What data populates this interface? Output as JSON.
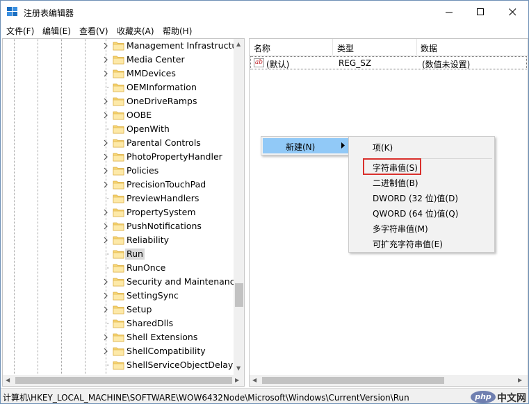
{
  "window": {
    "title": "注册表编辑器"
  },
  "menu": [
    "文件(F)",
    "编辑(E)",
    "查看(V)",
    "收藏夹(A)",
    "帮助(H)"
  ],
  "tree": {
    "items": [
      {
        "label": "Management Infrastructure",
        "expandable": true,
        "selected": false
      },
      {
        "label": "Media Center",
        "expandable": true,
        "selected": false
      },
      {
        "label": "MMDevices",
        "expandable": true,
        "selected": false
      },
      {
        "label": "OEMInformation",
        "expandable": false,
        "selected": false
      },
      {
        "label": "OneDriveRamps",
        "expandable": true,
        "selected": false
      },
      {
        "label": "OOBE",
        "expandable": true,
        "selected": false
      },
      {
        "label": "OpenWith",
        "expandable": false,
        "selected": false
      },
      {
        "label": "Parental Controls",
        "expandable": true,
        "selected": false
      },
      {
        "label": "PhotoPropertyHandler",
        "expandable": true,
        "selected": false
      },
      {
        "label": "Policies",
        "expandable": true,
        "selected": false
      },
      {
        "label": "PrecisionTouchPad",
        "expandable": true,
        "selected": false
      },
      {
        "label": "PreviewHandlers",
        "expandable": false,
        "selected": false
      },
      {
        "label": "PropertySystem",
        "expandable": true,
        "selected": false
      },
      {
        "label": "PushNotifications",
        "expandable": true,
        "selected": false
      },
      {
        "label": "Reliability",
        "expandable": true,
        "selected": false
      },
      {
        "label": "Run",
        "expandable": false,
        "selected": true
      },
      {
        "label": "RunOnce",
        "expandable": false,
        "selected": false
      },
      {
        "label": "Security and Maintenance",
        "expandable": true,
        "selected": false
      },
      {
        "label": "SettingSync",
        "expandable": true,
        "selected": false
      },
      {
        "label": "Setup",
        "expandable": true,
        "selected": false
      },
      {
        "label": "SharedDlls",
        "expandable": false,
        "selected": false
      },
      {
        "label": "Shell Extensions",
        "expandable": true,
        "selected": false
      },
      {
        "label": "ShellCompatibility",
        "expandable": true,
        "selected": false
      },
      {
        "label": "ShellServiceObjectDelayLoad",
        "expandable": false,
        "selected": false
      }
    ]
  },
  "list": {
    "columns": [
      "名称",
      "类型",
      "数据"
    ],
    "rows": [
      {
        "name": "(默认)",
        "type": "REG_SZ",
        "data": "(数值未设置)"
      }
    ]
  },
  "context_menu": {
    "parent": {
      "label": "新建(N)"
    },
    "submenu": [
      "项(K)",
      "字符串值(S)",
      "二进制值(B)",
      "DWORD (32 位)值(D)",
      "QWORD (64 位)值(Q)",
      "多字符串值(M)",
      "可扩充字符串值(E)"
    ],
    "highlighted_item": "字符串值(S)",
    "highlight_color": "#d9302c",
    "hover_color": "#91c9f7"
  },
  "status": {
    "path": "计算机\\HKEY_LOCAL_MACHINE\\SOFTWARE\\WOW6432Node\\Microsoft\\Windows\\CurrentVersion\\Run"
  },
  "watermark": {
    "php": "php",
    "cn": "中文网"
  }
}
